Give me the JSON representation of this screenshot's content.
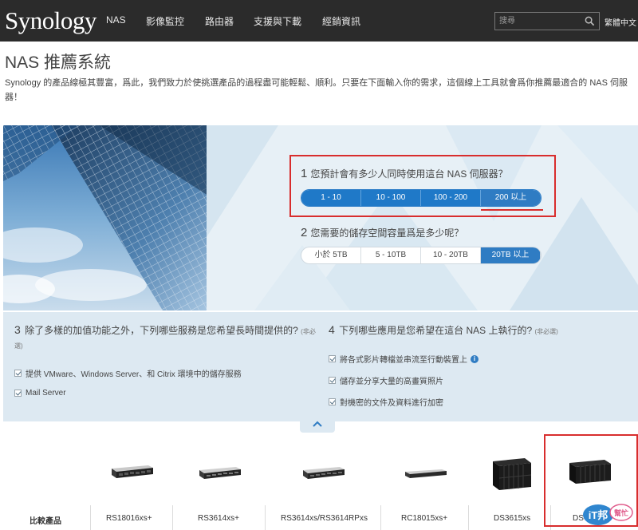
{
  "header": {
    "logo": "Synology",
    "nav": [
      "NAS",
      "影像監控",
      "路由器",
      "支援與下載",
      "經銷資訊"
    ],
    "search_placeholder": "搜尋",
    "language": "繁體中文"
  },
  "page": {
    "title": "NAS 推薦系統",
    "intro": "Synology 的產品線極其豐富，爲此，我們致力於使挑選產品的過程盡可能輕鬆、順利。只要在下面輸入你的需求，這個線上工具就會爲你推薦最適合的 NAS 伺服器！"
  },
  "q1": {
    "num": "1",
    "text": "您預計會有多少人同時使用這台 NAS 伺服器？",
    "options": [
      "1 - 10",
      "10 - 100",
      "100 - 200",
      "200 以上"
    ],
    "selected": "200 以上"
  },
  "q2": {
    "num": "2",
    "text": "您需要的儲存空間容量爲是多少呢？",
    "options": [
      "小於 5TB",
      "5 - 10TB",
      "10 - 20TB",
      "20TB 以上"
    ],
    "selected": "20TB 以上"
  },
  "q3": {
    "num": "3",
    "text": "除了多樣的加值功能之外，下列哪些服務是您希望長時間提供的?",
    "note": "(非必",
    "note2": "選)",
    "items": [
      "提供 VMware、Windows Server、和 Citrix 環境中的儲存服務",
      "Mail Server"
    ]
  },
  "q4": {
    "num": "4",
    "text": "下列哪些應用是您希望在這台 NAS 上執行的?",
    "note": "(非必選)",
    "items": [
      "將各式影片轉檔並串流至行動裝置上",
      "儲存並分享大量的高畫質照片",
      "對機密的文件及資料進行加密"
    ],
    "info_icon": "i"
  },
  "products": {
    "compare_label": "比較產品",
    "items": [
      "RS18016xs+",
      "RS3614xs+",
      "RS3614xs/RS3614RPxs",
      "RC18015xs+",
      "DS3615xs",
      "DS"
    ]
  },
  "watermark": {
    "main": "iT邦",
    "sub": "幫忙"
  },
  "colors": {
    "nav_bg": "#2b2b2b",
    "accent_blue": "#1f79c8",
    "highlight_red": "#d82d2d",
    "panel_bg": "#dde9f2"
  }
}
